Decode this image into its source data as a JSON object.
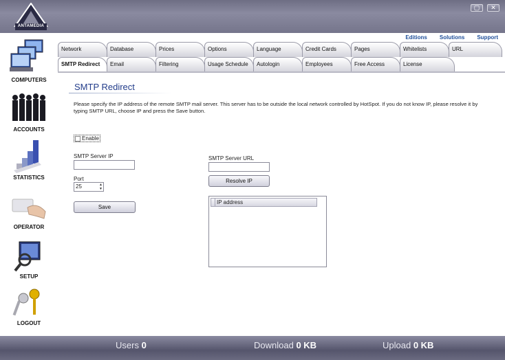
{
  "app": {
    "logo_text": "ANTAMEDIA"
  },
  "window": {
    "restore_glyph": "▢",
    "close_glyph": "✕"
  },
  "sidebar": {
    "items": [
      {
        "label": "COMPUTERS",
        "icon": "computers-icon"
      },
      {
        "label": "ACCOUNTS",
        "icon": "accounts-icon"
      },
      {
        "label": "STATISTICS",
        "icon": "statistics-icon"
      },
      {
        "label": "OPERATOR",
        "icon": "operator-icon"
      },
      {
        "label": "SETUP",
        "icon": "setup-icon"
      },
      {
        "label": "LOGOUT",
        "icon": "logout-icon"
      }
    ]
  },
  "toplinks": {
    "editions": "Editions",
    "solutions": "Solutions",
    "support": "Support"
  },
  "tabs_row1": [
    "Network",
    "Database",
    "Prices",
    "Options",
    "Language",
    "Credit Cards",
    "Pages",
    "Whitelists",
    "URL"
  ],
  "tabs_row2": [
    "SMTP Redirect",
    "Email",
    "Filtering",
    "Usage Schedule",
    "Autologin",
    "Employees",
    "Free Access",
    "License"
  ],
  "active_tab": "SMTP Redirect",
  "panel": {
    "title": "SMTP Redirect",
    "description": "Please specify the IP address of the remote SMTP mail server. This server has to be outside the local network controlled by HotSpot. If you do not know IP, please resolve it by typing SMTP URL, choose IP and press the Save button.",
    "enable_label": "Enable",
    "enable_checked": false,
    "smtp_ip_label": "SMTP Server IP",
    "smtp_ip_value": "",
    "port_label": "Port",
    "port_value": "25",
    "save_label": "Save",
    "smtp_url_label": "SMTP Server URL",
    "smtp_url_value": "",
    "resolve_label": "Resolve IP",
    "ip_column": "IP address"
  },
  "status": {
    "users_label": "Users",
    "users_value": "0",
    "download_label": "Download",
    "download_value": "0 KB",
    "upload_label": "Upload",
    "upload_value": "0 KB"
  },
  "colors": {
    "accent": "#1f4f9a",
    "title": "#223c8a",
    "frame": "#6e6e84"
  }
}
